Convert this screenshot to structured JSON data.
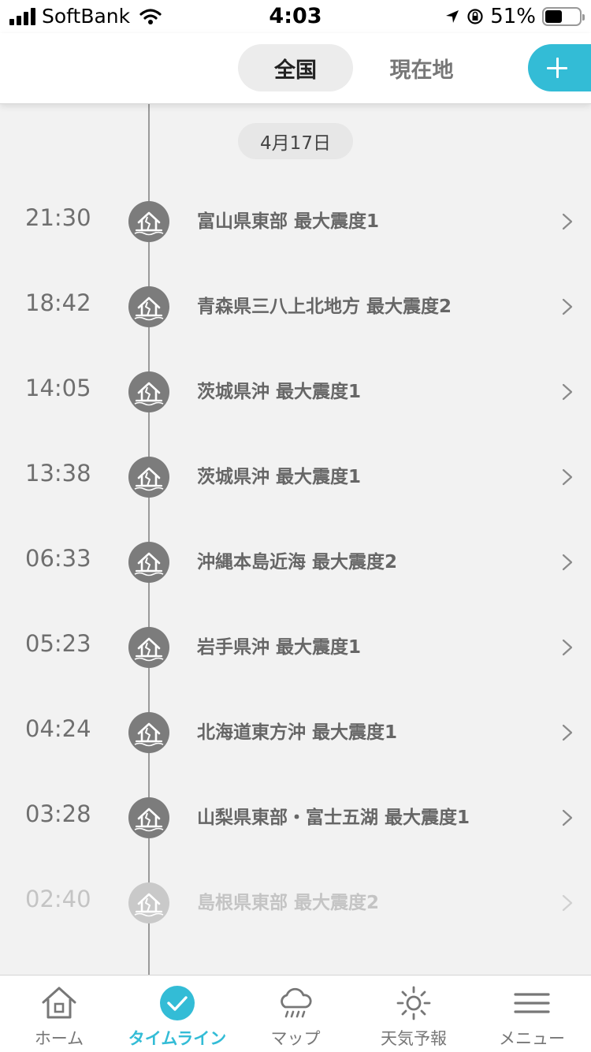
{
  "status_bar": {
    "carrier": "SoftBank",
    "time": "4:03",
    "battery": "51%",
    "battery_level": 0.51
  },
  "header": {
    "tabs": [
      {
        "label": "全国",
        "active": true
      },
      {
        "label": "現在地",
        "active": false
      }
    ],
    "add_icon": "plus-icon",
    "accent_color": "#33bcd6"
  },
  "timeline": {
    "date": "4月17日",
    "items": [
      {
        "time": "21:30",
        "label": "富山県東部 最大震度1"
      },
      {
        "time": "18:42",
        "label": "青森県三八上北地方 最大震度2"
      },
      {
        "time": "14:05",
        "label": "茨城県沖 最大震度1"
      },
      {
        "time": "13:38",
        "label": "茨城県沖 最大震度1"
      },
      {
        "time": "06:33",
        "label": "沖縄本島近海 最大震度2"
      },
      {
        "time": "05:23",
        "label": "岩手県沖 最大震度1"
      },
      {
        "time": "04:24",
        "label": "北海道東方沖 最大震度1"
      },
      {
        "time": "03:28",
        "label": "山梨県東部・富士五湖 最大震度1"
      },
      {
        "time": "02:40",
        "label": "島根県東部 最大震度2"
      }
    ]
  },
  "bottom_nav": {
    "items": [
      {
        "label": "ホーム",
        "icon": "home-icon",
        "active": false
      },
      {
        "label": "タイムライン",
        "icon": "check-circle-icon",
        "active": true
      },
      {
        "label": "マップ",
        "icon": "rain-cloud-icon",
        "active": false
      },
      {
        "label": "天気予報",
        "icon": "sun-icon",
        "active": false
      },
      {
        "label": "メニュー",
        "icon": "menu-icon",
        "active": false
      }
    ]
  }
}
